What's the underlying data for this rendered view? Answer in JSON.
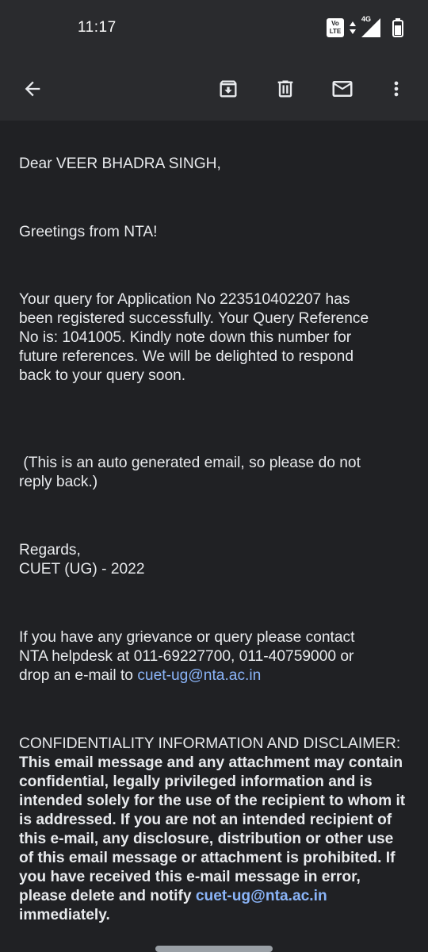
{
  "status_bar": {
    "time": "11:17",
    "volte_line1": "Vo",
    "volte_line2": "LTE",
    "network": "4G"
  },
  "toolbar": {
    "icons": [
      "back-arrow-icon",
      "archive-icon",
      "delete-icon",
      "mail-icon",
      "more-vert-icon"
    ]
  },
  "email": {
    "salutation": "Dear VEER BHADRA SINGH,",
    "greeting": "Greetings from NTA!",
    "query_line1": "Your query for Application No 223510402207 has",
    "query_line2": "been registered successfully. Your Query Reference",
    "query_line3": "No is: 1041005. Kindly note down this number for",
    "query_line4": "future references. We will be delighted to respond",
    "query_line5": "back to your query soon.",
    "auto_line1": " (This is an auto generated email, so please do not",
    "auto_line2": "reply back.)",
    "regards": "Regards,",
    "signature": "CUET (UG) - 2022",
    "contact_line1": "If you have any grievance or query please contact",
    "contact_line2": "NTA helpdesk at 011-69227700, 011-40759000 or",
    "contact_line3_prefix": "drop an e-mail to ",
    "contact_email": "cuet-ug@nta.ac.in",
    "disclaimer_heading": "CONFIDENTIALITY INFORMATION AND DISCLAIMER:",
    "disclaimer_line1": "This email message and any attachment may contain",
    "disclaimer_line2": "confidential, legally privileged information and is",
    "disclaimer_line3": "intended solely for the use of the recipient to whom it",
    "disclaimer_line4": "is addressed. If you are not an intended recipient of",
    "disclaimer_line5": "this e-mail, any disclosure, distribution or other use",
    "disclaimer_line6": "of this email message or attachment is prohibited. If",
    "disclaimer_line7": "you have received this e-mail message in error,",
    "disclaimer_line8_prefix": "please delete and notify ",
    "disclaimer_email": "cuet-ug@nta.ac.in",
    "disclaimer_line9": "immediately."
  },
  "colors": {
    "background": "#202124",
    "toolbar": "#2a2b2e",
    "text": "#e8eaed",
    "link": "#8ab4f8"
  }
}
